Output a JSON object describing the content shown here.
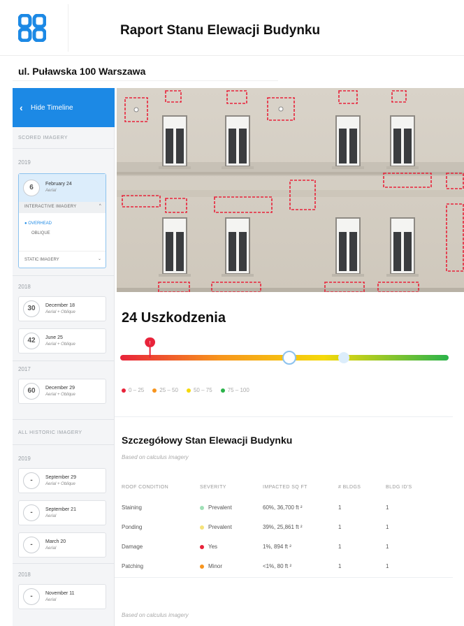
{
  "header": {
    "title": "Raport Stanu Elewacji Budynku"
  },
  "address": "ul. Puławska 100 Warszawa",
  "sidebar": {
    "hide_timeline": "Hide Timeline",
    "scored_imagery_title": "SCORED IMAGERY",
    "years": [
      "2019",
      "2018",
      "2017"
    ],
    "active_card": {
      "score": "6",
      "date": "February 24",
      "sub": "Aerial",
      "interactive_label": "INTERACTIVE IMAGERY",
      "option_selected": "OVERHEAD",
      "option_other": "OBLIQUE",
      "static_label": "STATIC IMAGERY"
    },
    "scored_cards": [
      {
        "score": "30",
        "date": "December 18",
        "sub": "Aerial + Oblique"
      },
      {
        "score": "42",
        "date": "June 25",
        "sub": "Aerial + Oblique"
      },
      {
        "score": "60",
        "date": "December 29",
        "sub": "Aerial + Oblique"
      }
    ],
    "historic_title": "ALL HISTORIC IMAGERY",
    "historic_years": [
      "2019",
      "2018"
    ],
    "historic_cards": [
      {
        "score": "-",
        "date": "September 29",
        "sub": "Aerial + Oblique"
      },
      {
        "score": "-",
        "date": "September 21",
        "sub": "Aerial"
      },
      {
        "score": "-",
        "date": "March 20",
        "sub": "Aerial"
      },
      {
        "score": "-",
        "date": "November 11",
        "sub": "Aerial"
      }
    ]
  },
  "summary": {
    "damage_count": "24 Uszkodzenia",
    "gauge_value": 8,
    "gauge_marker_label": "!",
    "legend": [
      {
        "label": "0 – 25",
        "color": "#e8233a"
      },
      {
        "label": "25 – 50",
        "color": "#f7941d"
      },
      {
        "label": "50 – 75",
        "color": "#f5d90a"
      },
      {
        "label": "75 – 100",
        "color": "#2bb34a"
      }
    ]
  },
  "details": {
    "title": "Szczegółowy Stan Elewacji Budynku",
    "note": "Based on calculus imagery",
    "columns": [
      "ROOF CONDITION",
      "SEVERITY",
      "IMPACTED SQ FT",
      "# BLDGS",
      "BLDG ID'S"
    ],
    "rows": [
      {
        "condition": "Staining",
        "severity": "Prevalent",
        "sev_color": "#9fe0b6",
        "impacted": "60%, 36,700 ft ²",
        "bldgs": "1",
        "ids": "1"
      },
      {
        "condition": "Ponding",
        "severity": "Prevalent",
        "sev_color": "#f5e27a",
        "impacted": "39%, 25,861 ft ²",
        "bldgs": "1",
        "ids": "1"
      },
      {
        "condition": "Damage",
        "severity": "Yes",
        "sev_color": "#e8233a",
        "impacted": "1%, 894 ft ²",
        "bldgs": "1",
        "ids": "1"
      },
      {
        "condition": "Patching",
        "severity": "Minor",
        "sev_color": "#f7941d",
        "impacted": "<1%, 80 ft ²",
        "bldgs": "1",
        "ids": "1"
      }
    ],
    "footer_note": "Based on calculus imagery"
  }
}
